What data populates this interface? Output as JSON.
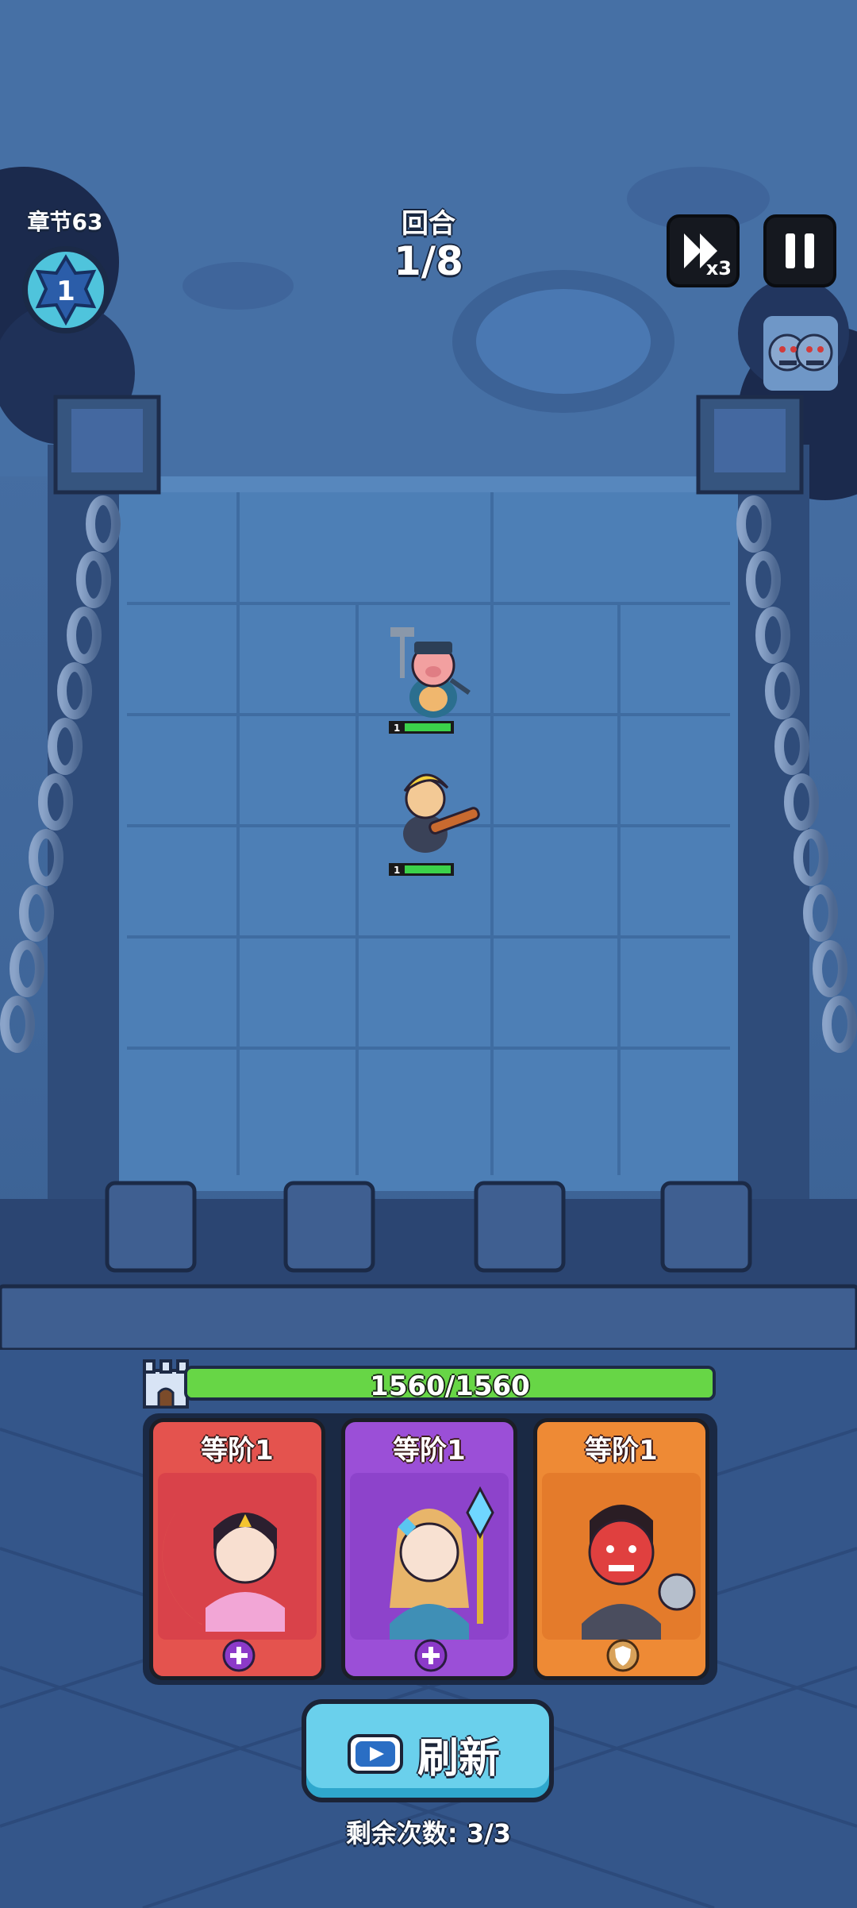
{
  "chapter": {
    "label": "章节63",
    "level": "1"
  },
  "round": {
    "title": "回合",
    "value": "1/8"
  },
  "controls": {
    "speed_multiplier": "x3",
    "speed_icon": "fast-forward-icon",
    "pause_icon": "pause-icon"
  },
  "units": [
    {
      "name": "pig-cop-hero",
      "level": "1",
      "hp_fraction": 1.0
    },
    {
      "name": "blonde-swordsman-hero",
      "level": "1",
      "hp_fraction": 1.0
    }
  ],
  "base": {
    "hp_text": "1560/1560",
    "hp_fraction": 1.0
  },
  "cards": [
    {
      "tier": "等阶1",
      "hero": "moon-princess",
      "action_icon": "plus-icon",
      "color": "#e4534e"
    },
    {
      "tier": "等阶1",
      "hero": "crystal-mage",
      "action_icon": "plus-icon",
      "color": "#9b4fd7"
    },
    {
      "tier": "等阶1",
      "hero": "red-ogre-warrior",
      "action_icon": "shield-icon",
      "color": "#ee8a35"
    }
  ],
  "refresh": {
    "label": "刷新",
    "icon": "video-play-icon",
    "remaining": "剩余次数: 3/3"
  },
  "colors": {
    "hp_green": "#67d646",
    "refresh_blue": "#6ad0ec"
  }
}
